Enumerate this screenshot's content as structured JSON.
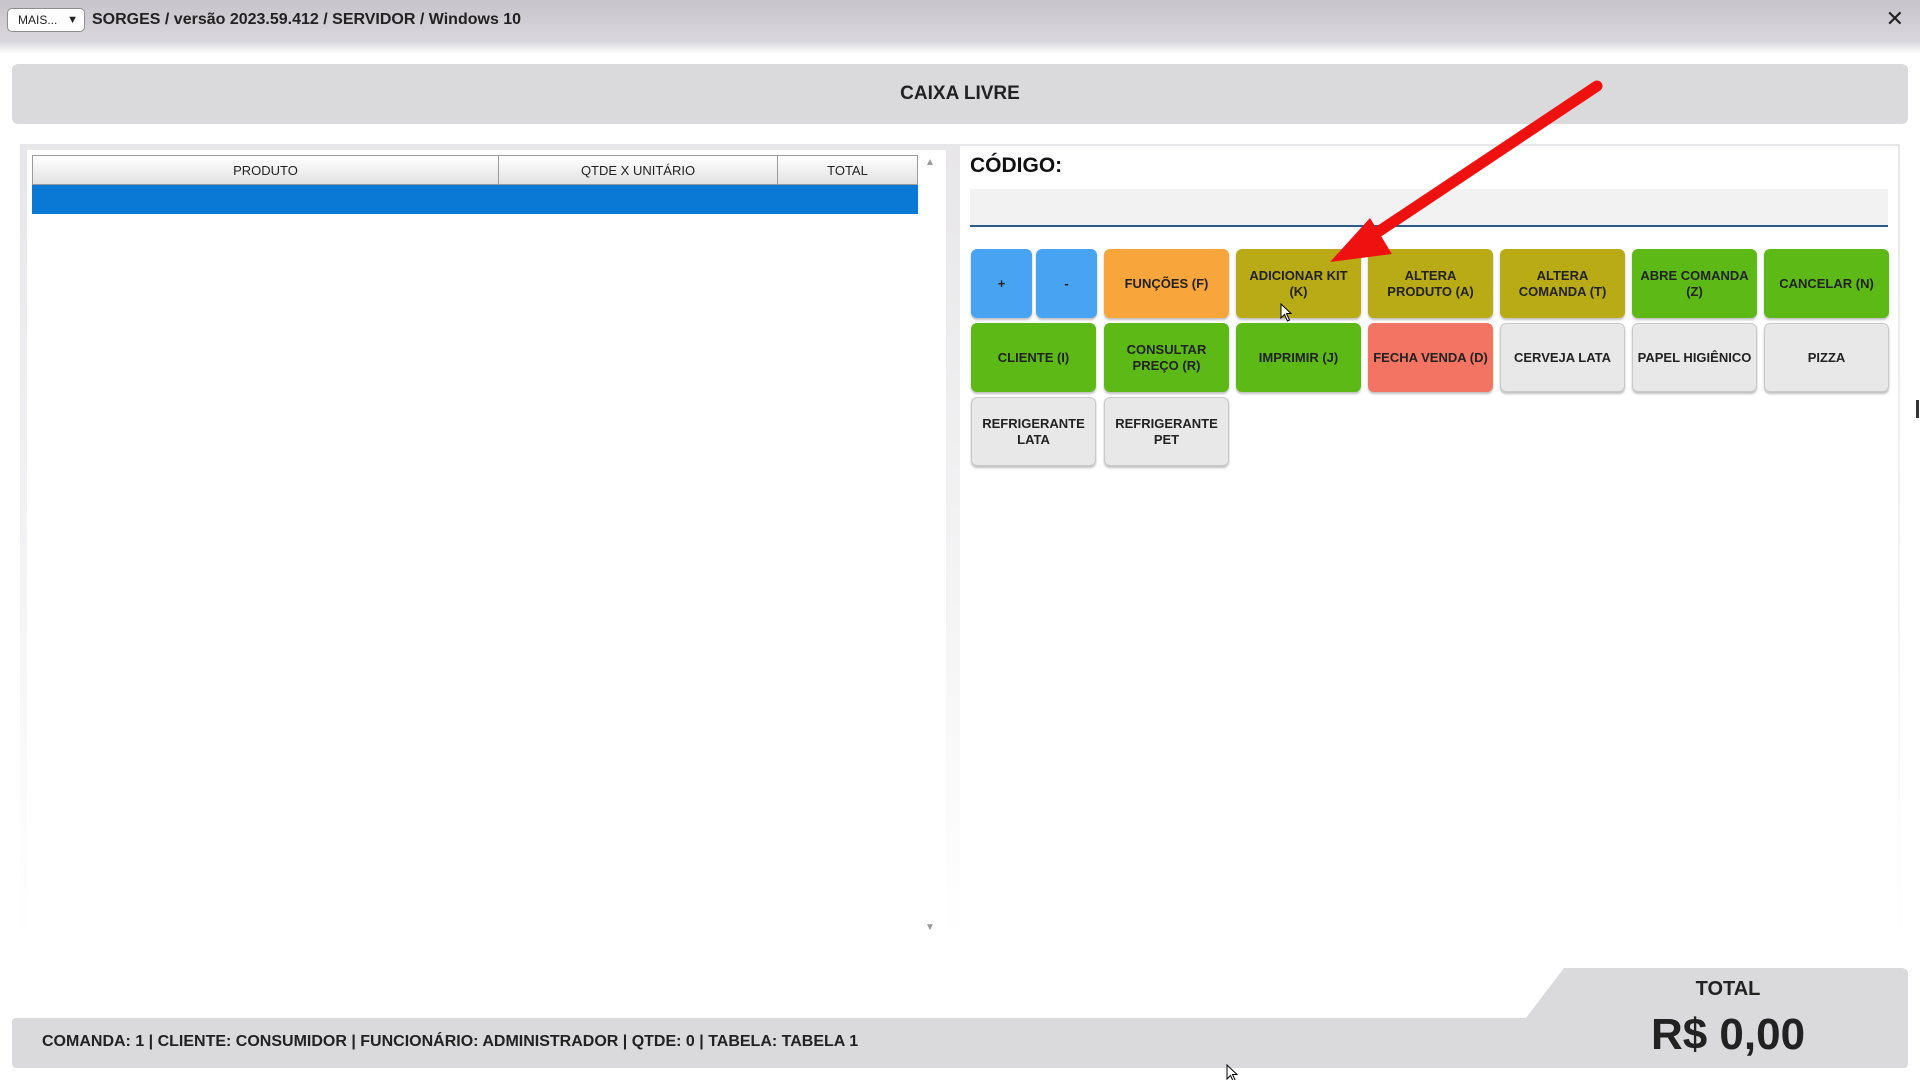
{
  "window": {
    "more_label": "MAIS...",
    "more_caret": "▼",
    "title": "SORGES / versão 2023.59.412 / SERVIDOR / Windows 10",
    "close_glyph": "✕"
  },
  "status": {
    "text": "CAIXA LIVRE"
  },
  "grid": {
    "columns": [
      "PRODUTO",
      "QTDE X UNITÁRIO",
      "TOTAL"
    ],
    "rows": [],
    "scroll_up": "▲",
    "scroll_down": "▼"
  },
  "code": {
    "label": "CÓDIGO:",
    "value": "",
    "placeholder": ""
  },
  "buttons": [
    {
      "label": "+",
      "color": "#48a4f2"
    },
    {
      "label": "-",
      "color": "#48a4f2"
    },
    {
      "label": "FUNÇÕES (F)",
      "color": "#f8a53c"
    },
    {
      "label": "ADICIONAR KIT (K)",
      "color": "#b9ab15"
    },
    {
      "label": "ALTERA PRODUTO (A)",
      "color": "#b9ab15"
    },
    {
      "label": "ALTERA COMANDA (T)",
      "color": "#b9ab15"
    },
    {
      "label": "ABRE COMANDA (Z)",
      "color": "#5dba16"
    },
    {
      "label": "CANCELAR (N)",
      "color": "#5dba16"
    },
    {
      "label": "CLIENTE (I)",
      "color": "#5dba16"
    },
    {
      "label": "CONSULTAR PREÇO (R)",
      "color": "#5dba16"
    },
    {
      "label": "IMPRIMIR (J)",
      "color": "#5dba16"
    },
    {
      "label": "FECHA VENDA (D)",
      "color": "#f37463"
    },
    {
      "label": "CERVEJA LATA",
      "color": "#e8e8e8"
    },
    {
      "label": "PAPEL HIGIÊNICO",
      "color": "#e8e8e8"
    },
    {
      "label": "PIZZA",
      "color": "#e8e8e8"
    },
    {
      "label": "REFRIGERANTE LATA",
      "color": "#e8e8e8"
    },
    {
      "label": "REFRIGERANTE PET",
      "color": "#e8e8e8"
    }
  ],
  "footer": {
    "info": "COMANDA: 1  |  CLIENTE: CONSUMIDOR  |  FUNCIONÁRIO: ADMINISTRADOR  |  QTDE: 0  |  TABELA: TABELA 1",
    "total_label": "TOTAL",
    "total_value": "R$ 0,00"
  },
  "annotation": {
    "arrow_color": "#ef1010"
  }
}
